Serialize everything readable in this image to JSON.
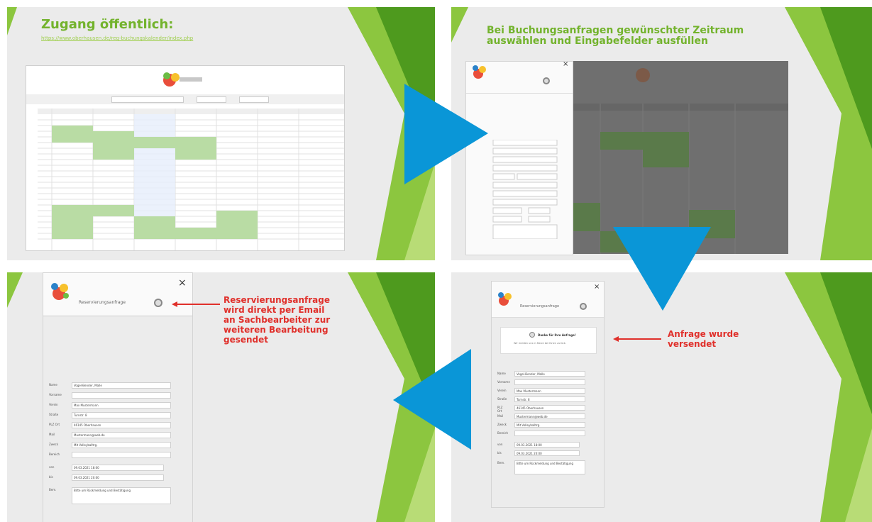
{
  "slides": {
    "s1": {
      "title": "Zugang öffentlich:",
      "link": "https://www.oberhausen.de/reg-buchungskalender/index.php"
    },
    "s2": {
      "title_line1": "Bei Buchungsanfragen gewünschter Zeitraum",
      "title_line2": "auswählen und Eingabefelder ausfüllen"
    },
    "s3": {
      "form_title": "Reservierungsanfrage",
      "note_lines": [
        "Reservierungsanfrage",
        "wird direkt per Email",
        "an Sachbearbeiter zur",
        "weiteren Bearbeitung",
        "gesendet"
      ],
      "fields": [
        {
          "label": "Name",
          "value": "Vogel-Bender, Malle"
        },
        {
          "label": "Vorname",
          "value": ""
        },
        {
          "label": "Verein",
          "value": "Max Mustermann"
        },
        {
          "label": "Straße",
          "value": "Turnstr. 8"
        },
        {
          "label": "PLZ Ort",
          "value": "46145    Oberhausen"
        },
        {
          "label": "Mail",
          "value": "Mustermann@web.de"
        },
        {
          "label": "Zweck",
          "value": "Mit Volleyballtrg."
        },
        {
          "label": "Bereich",
          "value": ""
        },
        {
          "label": "von",
          "value": "09.03.2021    18:00"
        },
        {
          "label": "bis",
          "value": "09.03.2021    20:00"
        },
        {
          "label": "Bem.",
          "value": "Bitte um Rückmeldung und Bestätigung"
        }
      ]
    },
    "s4": {
      "form_title": "Reservierungsanfrage",
      "note_lines": [
        "Anfrage wurde",
        "versendet"
      ],
      "confirm_title": "Danke für Ihre Anfrage!",
      "confirm_sub": "Wir melden uns in Kürze bei Ihnen zurück.",
      "fields": [
        {
          "label": "Name",
          "value": "Vogel-Bender, Malle"
        },
        {
          "label": "Vorname",
          "value": ""
        },
        {
          "label": "Verein",
          "value": "Max Mustermann"
        },
        {
          "label": "Straße",
          "value": "Turnstr. 8"
        },
        {
          "label": "PLZ Ort",
          "value": "46145    Oberhausen"
        },
        {
          "label": "Mail",
          "value": "Mustermann@web.de"
        },
        {
          "label": "Zweck",
          "value": "Mit Volleyballtrg."
        },
        {
          "label": "Bereich",
          "value": ""
        },
        {
          "label": "von",
          "value": "09.03.2021    18:00"
        },
        {
          "label": "bis",
          "value": "09.03.2021    20:00"
        },
        {
          "label": "Bem.",
          "value": "Bitte um Rückmeldung und Bestätigung"
        }
      ]
    },
    "close_glyph": "×"
  },
  "colors": {
    "green_title": "#73b32d",
    "note_red": "#e0302b",
    "arrow_blue": "#0a96d7",
    "green_cell": "#b9dca4"
  }
}
